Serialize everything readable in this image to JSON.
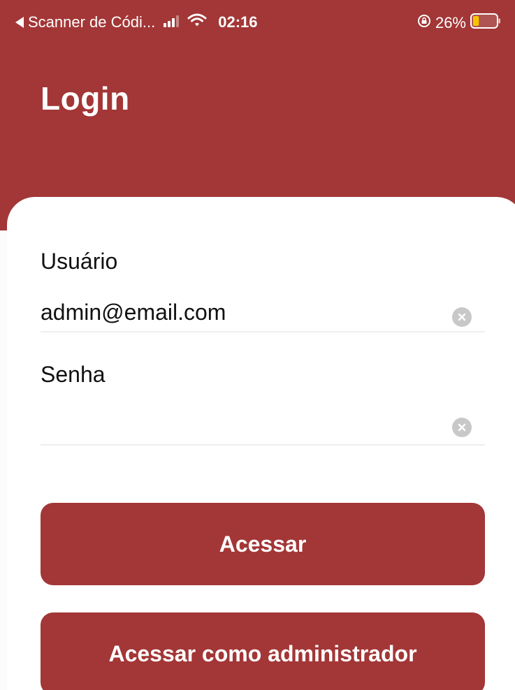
{
  "status_bar": {
    "back_app": "Scanner de Códi...",
    "time": "02:16",
    "battery_percent": "26%",
    "battery_level": 0.26
  },
  "header": {
    "title": "Login"
  },
  "form": {
    "username_label": "Usuário",
    "username_value": "admin@email.com",
    "password_label": "Senha",
    "password_value": ""
  },
  "buttons": {
    "login": "Acessar",
    "admin_login": "Acessar como administrador"
  },
  "colors": {
    "brand": "#a33636",
    "battery_low": "#f5c400"
  }
}
